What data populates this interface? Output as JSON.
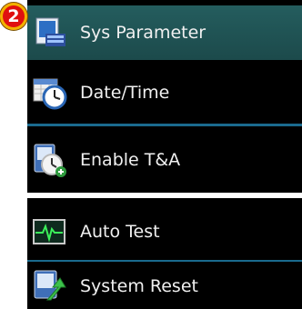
{
  "badge": {
    "number": "2"
  },
  "header": {
    "title": "Sys Parameter",
    "icon": "sys-parameter-icon"
  },
  "menu": {
    "items": [
      {
        "label": "Date/Time",
        "icon": "calendar-clock-icon"
      },
      {
        "label": "Enable T&A",
        "icon": "time-attendance-icon"
      },
      {
        "label": "Auto Test",
        "icon": "waveform-monitor-icon"
      },
      {
        "label": "System Reset",
        "icon": "reset-arrow-icon"
      }
    ]
  },
  "colors": {
    "header_bg": "#245d5e",
    "separator": "#1a6a8e",
    "badge": "#e01010",
    "badge_ring": "#f2b200"
  }
}
